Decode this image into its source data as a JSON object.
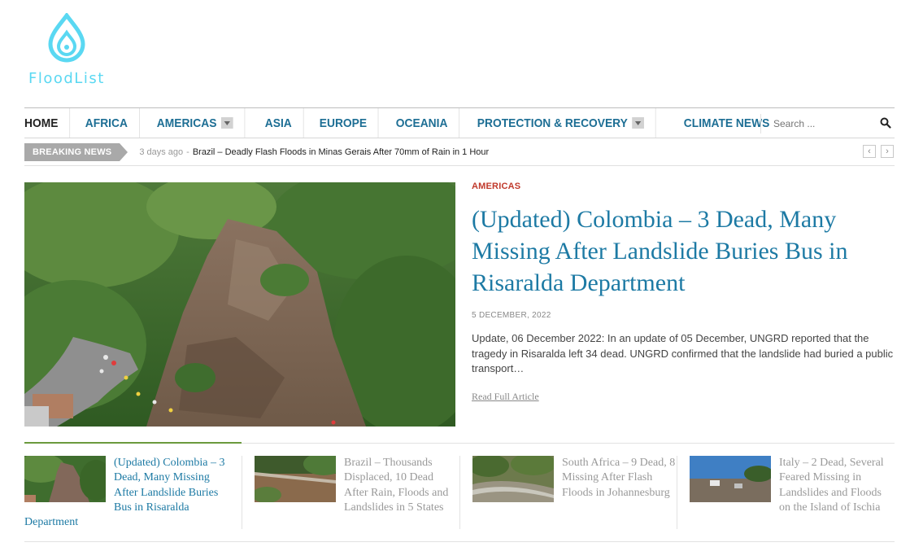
{
  "site": {
    "logo_text": "FloodList"
  },
  "nav": {
    "items": [
      {
        "label": "Home",
        "dropdown": false
      },
      {
        "label": "Africa",
        "dropdown": false
      },
      {
        "label": "Americas",
        "dropdown": true
      },
      {
        "label": "Asia",
        "dropdown": false
      },
      {
        "label": "Europe",
        "dropdown": false
      },
      {
        "label": "Oceania",
        "dropdown": false
      },
      {
        "label": "Protection & Recovery",
        "dropdown": true
      },
      {
        "label": "Climate News",
        "dropdown": false
      }
    ],
    "search_placeholder": "Search ..."
  },
  "breaking": {
    "label": "BREAKING NEWS",
    "time": "3 days ago",
    "separator": "-",
    "headline": "Brazil – Deadly Flash Floods in Minas Gerais After 70mm of Rain in 1 Hour"
  },
  "featured": {
    "category": "Americas",
    "title": "(Updated) Colombia – 3 Dead, Many Missing After Landslide Buries Bus in Risaralda Department",
    "date": "5 DECEMBER, 2022",
    "excerpt": "Update, 06 December 2022: In an update of 05 December, UNGRD reported that the tragedy in Risaralda left 34 dead. UNGRD confirmed that the landslide had buried a public transport…",
    "read_more": "Read Full Article"
  },
  "related": [
    {
      "title": "(Updated) Colombia – 3 Dead, Many Missing After Landslide Buries Bus in Risaralda Department",
      "active": true
    },
    {
      "title": "Brazil – Thousands Displaced, 10 Dead After Rain, Floods and Landslides in 5 States",
      "active": false
    },
    {
      "title": "South Africa – 9 Dead, 8 Missing After Flash Floods in Johannesburg",
      "active": false
    },
    {
      "title": "Italy – 2 Dead, Several Feared Missing in Landslides and Floods on the Island of Ischia",
      "active": false
    }
  ],
  "colors": {
    "link_blue": "#1d7aa4",
    "category_red": "#c0392b",
    "logo_cyan": "#5ad8f2",
    "active_green": "#6b9a3e"
  }
}
